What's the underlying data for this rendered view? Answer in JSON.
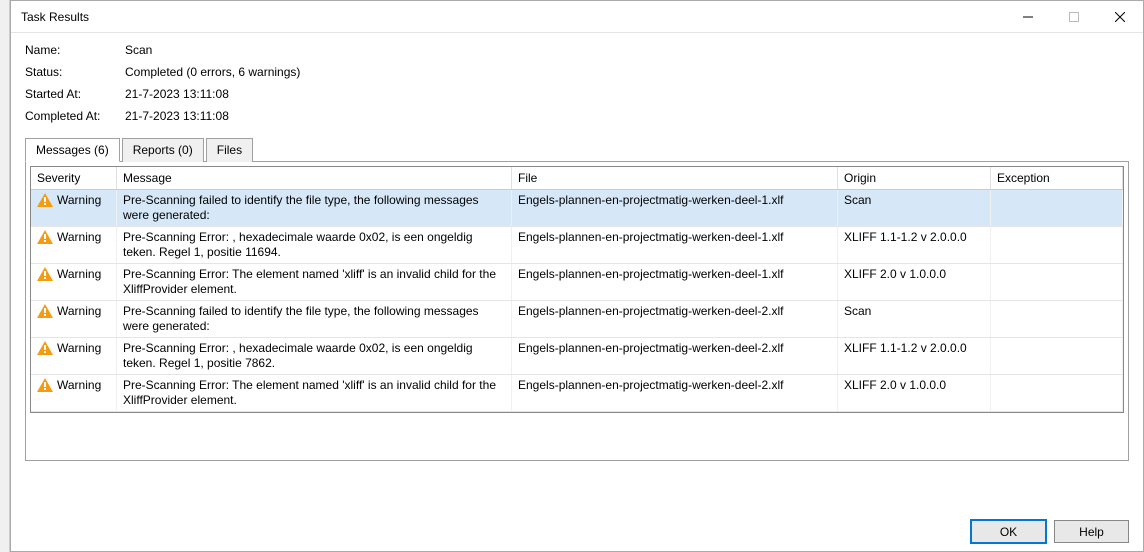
{
  "window": {
    "title": "Task Results"
  },
  "info": {
    "name_label": "Name:",
    "name_value": "Scan",
    "status_label": "Status:",
    "status_value": "Completed (0 errors, 6 warnings)",
    "started_label": "Started At:",
    "started_value": "21-7-2023 13:11:08",
    "completed_label": "Completed At:",
    "completed_value": "21-7-2023 13:11:08"
  },
  "tabs": {
    "messages": "Messages (6)",
    "reports": "Reports (0)",
    "files": "Files"
  },
  "grid": {
    "headers": {
      "severity": "Severity",
      "message": "Message",
      "file": "File",
      "origin": "Origin",
      "exception": "Exception"
    },
    "rows": [
      {
        "severity": "Warning",
        "message": "Pre-Scanning failed to identify the file type, the following messages were generated:",
        "file": "Engels-plannen-en-projectmatig-werken-deel-1.xlf",
        "origin": "Scan",
        "exception": ""
      },
      {
        "severity": "Warning",
        "message": "Pre-Scanning Error: , hexadecimale waarde 0x02, is een ongeldig teken. Regel 1, positie 11694.",
        "file": "Engels-plannen-en-projectmatig-werken-deel-1.xlf",
        "origin": "XLIFF 1.1-1.2 v 2.0.0.0",
        "exception": ""
      },
      {
        "severity": "Warning",
        "message": "Pre-Scanning Error: The element named 'xliff' is an invalid child for the XliffProvider element.",
        "file": "Engels-plannen-en-projectmatig-werken-deel-1.xlf",
        "origin": "XLIFF 2.0 v 1.0.0.0",
        "exception": ""
      },
      {
        "severity": "Warning",
        "message": "Pre-Scanning failed to identify the file type, the following messages were generated:",
        "file": "Engels-plannen-en-projectmatig-werken-deel-2.xlf",
        "origin": "Scan",
        "exception": ""
      },
      {
        "severity": "Warning",
        "message": "Pre-Scanning Error: , hexadecimale waarde 0x02, is een ongeldig teken. Regel 1, positie 7862.",
        "file": "Engels-plannen-en-projectmatig-werken-deel-2.xlf",
        "origin": "XLIFF 1.1-1.2 v 2.0.0.0",
        "exception": ""
      },
      {
        "severity": "Warning",
        "message": "Pre-Scanning Error: The element named 'xliff' is an invalid child for the XliffProvider element.",
        "file": "Engels-plannen-en-projectmatig-werken-deel-2.xlf",
        "origin": "XLIFF 2.0 v 1.0.0.0",
        "exception": ""
      }
    ]
  },
  "buttons": {
    "ok": "OK",
    "help": "Help"
  }
}
